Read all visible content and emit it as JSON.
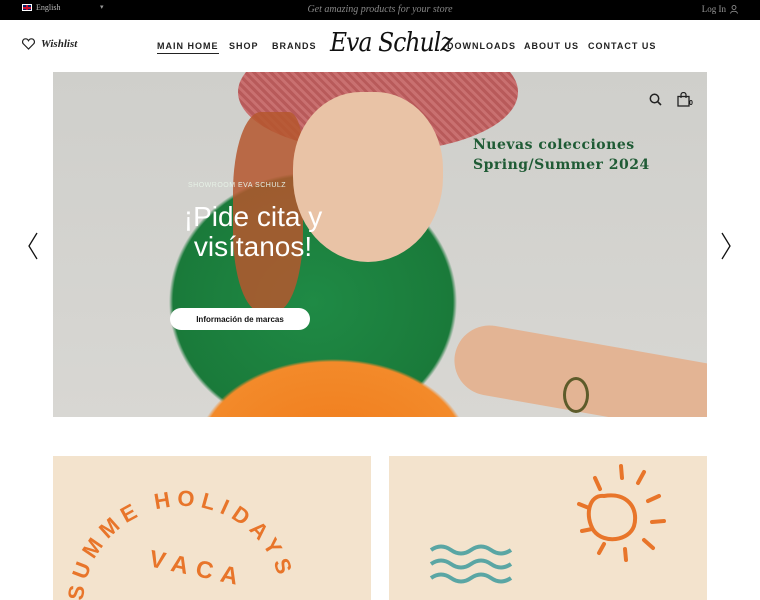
{
  "topbar": {
    "language": "English",
    "promo": "Get amazing products for your store",
    "login": "Log In"
  },
  "header": {
    "wishlist": "Wishlist",
    "logo": "Eva Schulz",
    "nav": [
      "MAIN HOME",
      "SHOP",
      "BRANDS",
      "DOWNLOADS",
      "ABOUT US",
      "CONTACT US"
    ],
    "cart_count": "0"
  },
  "hero": {
    "kicker": "SHOWROOM EVA SCHULZ",
    "title": "¡Pide cita y visítanos!",
    "button": "Información de marcas",
    "note_line1": "Nuevas colecciones",
    "note_line2": "Spring/Summer 2024"
  },
  "cards": {
    "left_text": "SUMMER HOLIDAYS VACATION",
    "left_color": "#e8752a",
    "right_sun_color": "#e8752a",
    "right_wave_color": "#5aa6a4"
  },
  "icons": [
    "heart-icon",
    "search-icon",
    "shopping-bag-icon",
    "hamburger-menu-icon",
    "chevron-left-icon",
    "chevron-right-icon",
    "user-icon",
    "chevron-down-icon",
    "sun-icon",
    "waves-icon"
  ]
}
